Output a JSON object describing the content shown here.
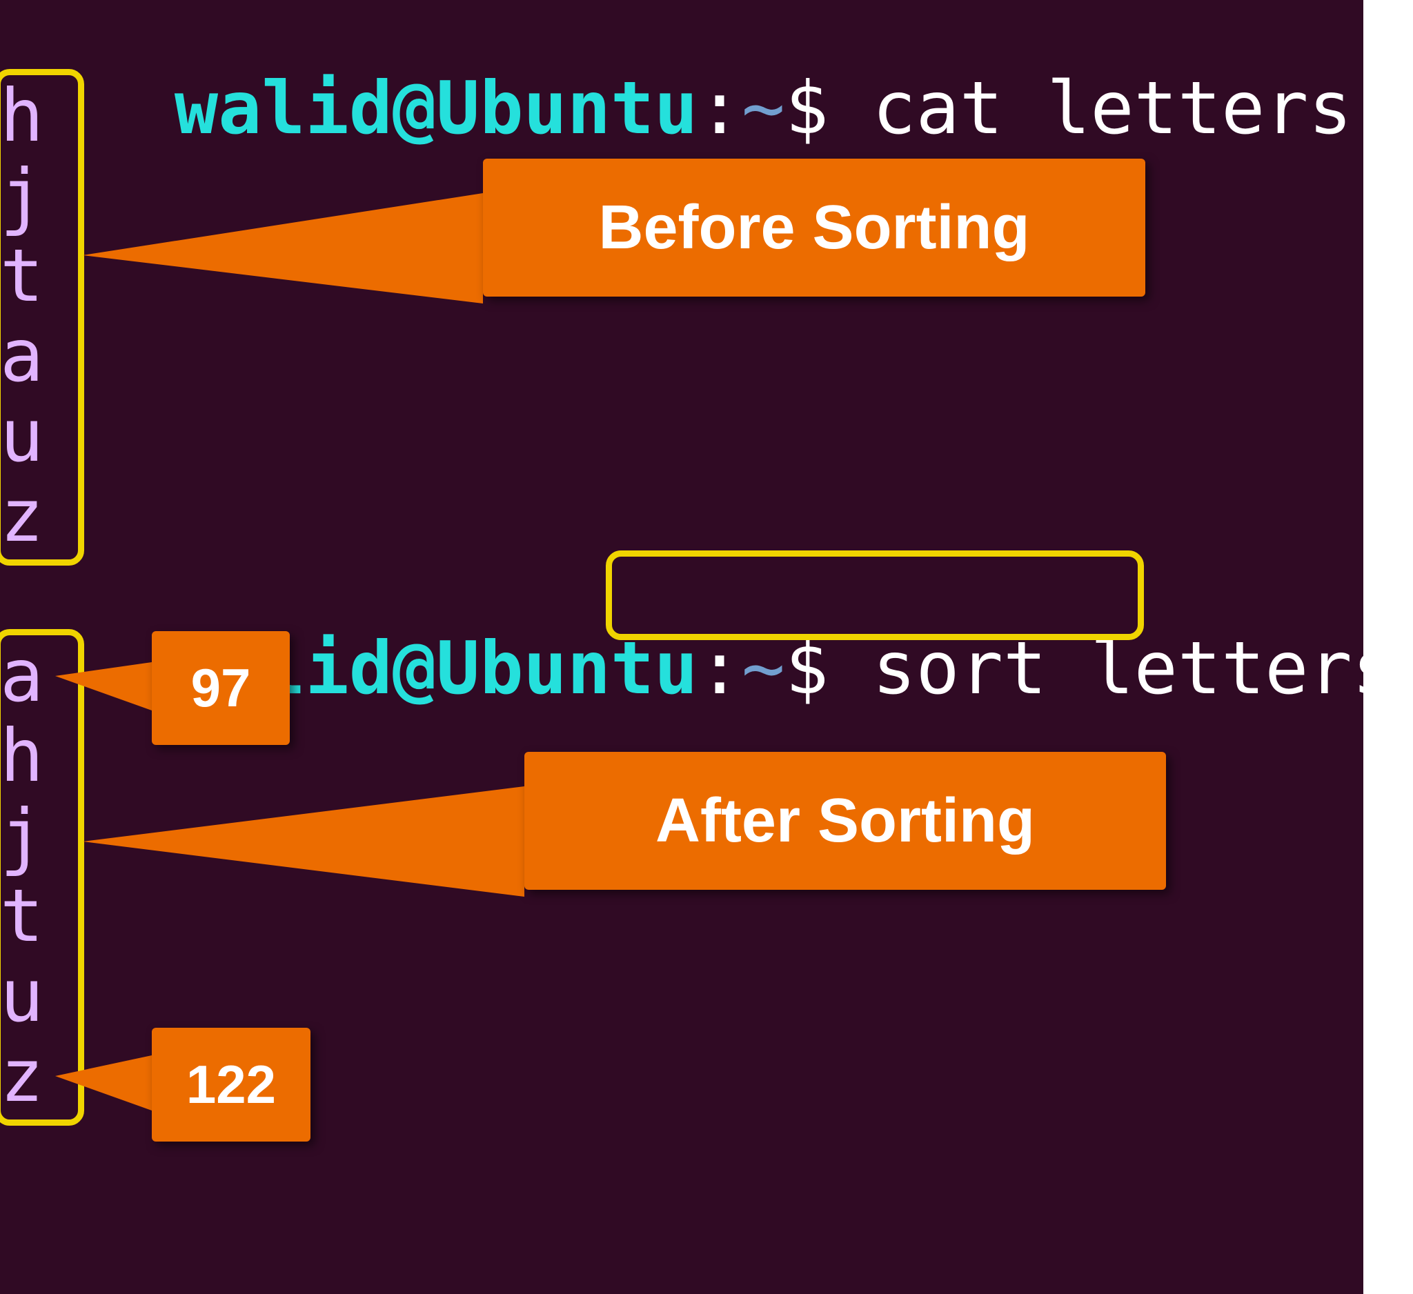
{
  "prompt": {
    "user": "walid",
    "at": "@",
    "host": "Ubuntu",
    "colon": ":",
    "cwd": "~",
    "dollar": "$"
  },
  "commands": {
    "cat": "cat letters",
    "sort": "sort letters"
  },
  "output_before": [
    "h",
    "j",
    "t",
    "a",
    "u",
    "z"
  ],
  "output_after": [
    "a",
    "h",
    "j",
    "t",
    "u",
    "z"
  ],
  "annotations": {
    "before_label": "Before Sorting",
    "after_label": "After Sorting",
    "ascii_a": "97",
    "ascii_z": "122"
  }
}
